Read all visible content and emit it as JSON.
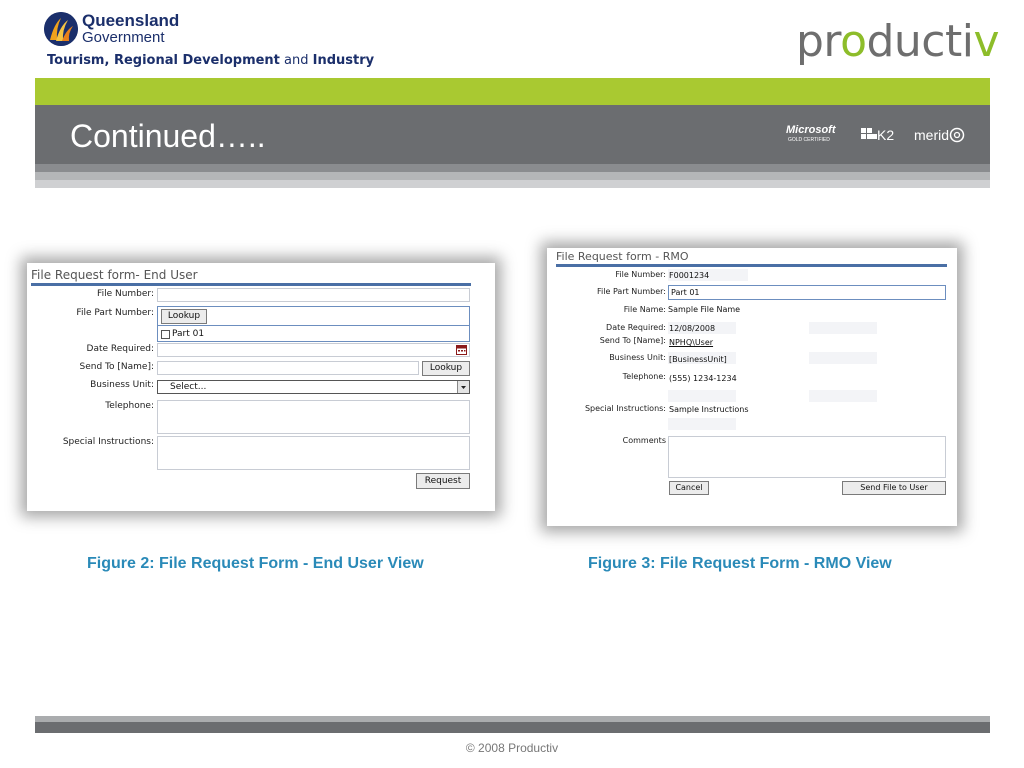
{
  "header": {
    "org_line1": "Queensland",
    "org_line2": "Government",
    "department": {
      "part1": "Tourism, Regional Development",
      "connector": "and",
      "part2": "Industry"
    },
    "brand": {
      "prefix": "pr",
      "mark": "o",
      "middle": "ducti",
      "suffix": "v"
    },
    "slide_title": "Continued…..",
    "partners": {
      "microsoft": "Microsoft",
      "microsoft_sub": "GOLD CERTIFIED",
      "k2": "K2",
      "meridio": "merid"
    },
    "colors": {
      "accent_green": "#a9c931",
      "header_grey": "#6b6d70",
      "navy": "#1b2f6b",
      "caption_blue": "#2a8ab8"
    }
  },
  "form_end_user": {
    "title": "File Request form- End User",
    "labels": {
      "file_number": "File Number:",
      "file_part_number": "File Part Number:",
      "date_required": "Date Required:",
      "send_to": "Send To [Name]:",
      "business_unit": "Business Unit:",
      "telephone": "Telephone:",
      "special_instructions": "Special Instructions:"
    },
    "lookup_label": "Lookup",
    "part_checkbox_label": "Part 01",
    "send_lookup_label": "Lookup",
    "business_unit_value": "Select...",
    "request_label": "Request",
    "icons": [
      "calendar-icon",
      "dropdown-arrow-icon",
      "checkbox-icon"
    ]
  },
  "form_rmo": {
    "title": "File Request form - RMO",
    "labels": {
      "file_number": "File Number:",
      "file_part_number": "File Part Number:",
      "file_name": "File Name:",
      "date_required": "Date Required:",
      "send_to": "Send To [Name]:",
      "business_unit": "Business Unit:",
      "telephone": "Telephone:",
      "special_instructions": "Special Instructions:",
      "comments": "Comments"
    },
    "values": {
      "file_number": "F0001234",
      "file_part_number": "Part 01",
      "file_name": "Sample File Name",
      "date_required": "12/08/2008",
      "send_to": "NPHQ\\User",
      "business_unit": "[BusinessUnit]",
      "telephone": "(555) 1234-1234",
      "special_instructions": "Sample Instructions"
    },
    "cancel_label": "Cancel",
    "send_label": "Send File to User"
  },
  "captions": {
    "figure2": "Figure 2: File Request Form - End User View",
    "figure3": "Figure 3: File Request Form - RMO View"
  },
  "footer": {
    "copyright": "© 2008 Productiv"
  }
}
